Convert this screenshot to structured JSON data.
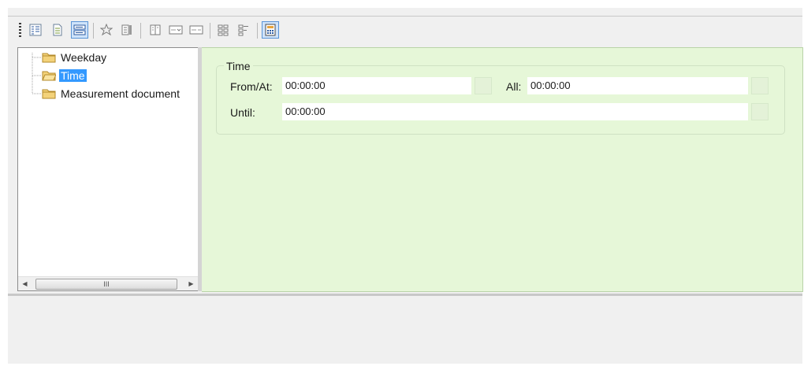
{
  "toolbar": {
    "buttons": [
      {
        "icon": "list-view-icon"
      },
      {
        "icon": "document-icon"
      },
      {
        "icon": "form-view-icon",
        "active": true
      },
      {
        "icon": "star-icon"
      },
      {
        "icon": "properties-icon"
      },
      {
        "icon": "column-icon"
      },
      {
        "icon": "dropdown-field-icon"
      },
      {
        "icon": "text-field-icon"
      },
      {
        "icon": "grid-layout-icon"
      },
      {
        "icon": "tree-layout-icon"
      },
      {
        "icon": "calculator-icon",
        "active": true
      }
    ]
  },
  "tree": {
    "items": [
      {
        "label": "Weekday"
      },
      {
        "label": "Time",
        "selected": true
      },
      {
        "label": "Measurement document"
      }
    ],
    "scrollbar": {
      "thumb_grip": "III"
    }
  },
  "form": {
    "group_title": "Time",
    "from_label": "From/At:",
    "from_value": "00:00:00",
    "all_label": "All:",
    "all_value": "00:00:00",
    "until_label": "Until:",
    "until_value": "00:00:00"
  },
  "colors": {
    "content_bg": "#e6f7d8",
    "selection": "#3399ff",
    "panel_bg": "#f0f0f0"
  }
}
